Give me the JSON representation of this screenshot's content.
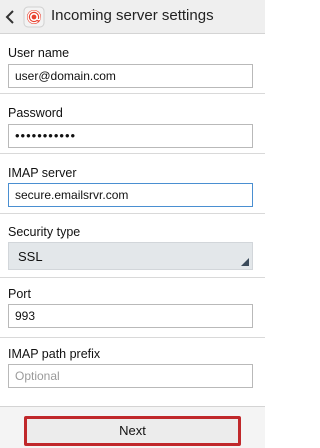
{
  "header": {
    "title": "Incoming server settings",
    "back_icon": "chevron-left-icon",
    "app_icon": "email-app-icon",
    "brand_color": "#e8412f"
  },
  "form": {
    "username": {
      "label": "User name",
      "value": "user@domain.com"
    },
    "password": {
      "label": "Password",
      "value": "•••••••••••"
    },
    "imap_server": {
      "label": "IMAP server",
      "value": "secure.emailsrvr.com"
    },
    "security_type": {
      "label": "Security type",
      "value": "SSL"
    },
    "port": {
      "label": "Port",
      "value": "993"
    },
    "imap_path_prefix": {
      "label": "IMAP path prefix",
      "placeholder": "Optional"
    }
  },
  "footer": {
    "next_label": "Next",
    "highlight_color": "#c0282b"
  }
}
